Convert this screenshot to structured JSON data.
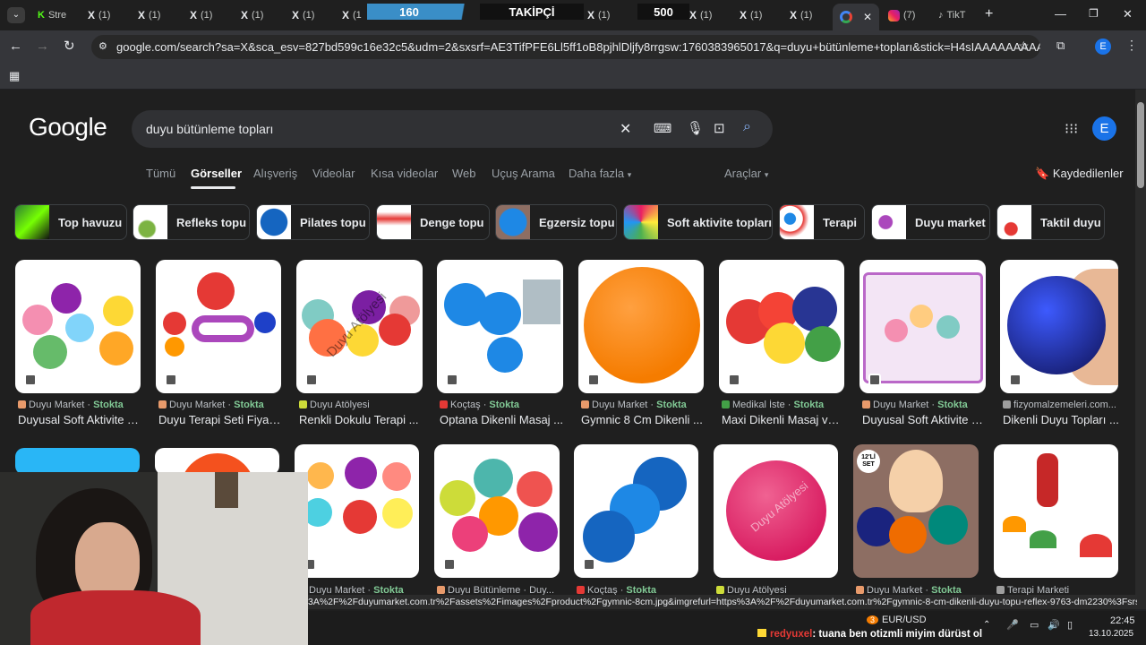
{
  "browser": {
    "tabs": [
      {
        "label": "Stre"
      },
      {
        "label": "(1)"
      },
      {
        "label": "(1)"
      },
      {
        "label": "(1)"
      },
      {
        "label": "(1)"
      },
      {
        "label": "(1)"
      },
      {
        "label": "(1"
      },
      {
        "label": "(1)"
      },
      {
        "label": "(1)"
      },
      {
        "label": "(1)"
      },
      {
        "label": "(1)"
      },
      {
        "label": "(1"
      },
      {
        "label": ""
      },
      {
        "label": "(7)"
      },
      {
        "label": "TikT"
      }
    ],
    "overlay": {
      "count1": "160",
      "label": "TAKİPÇİ",
      "count2": "500"
    },
    "url": "google.com/search?sa=X&sca_esv=827bd599c16e32c5&udm=2&sxsrf=AE3TifPFE6Ll5ff1oB8pjhlDljfy8rrgsw:1760383965017&q=duyu+bütünleme+topları&stick=H4sIAAAAAAAAAFvEKpISWIm...",
    "profile_letter": "E",
    "new_tab": "+"
  },
  "google": {
    "logo": "Google",
    "query": "duyu bütünleme topları",
    "avatar": "E",
    "nav": [
      "Tümü",
      "Görseller",
      "Alışveriş",
      "Videolar",
      "Kısa videolar",
      "Web",
      "Uçuş Arama",
      "Daha fazla"
    ],
    "tools": "Araçlar",
    "saved": "Kaydedilenler",
    "chips": [
      "Top havuzu",
      "Refleks topu",
      "Pilates topu",
      "Denge topu",
      "Egzersiz topu",
      "Soft aktivite topları",
      "Terapi",
      "Duyu market",
      "Taktil duyu"
    ],
    "row1": [
      {
        "source": "Duyu Market",
        "stock": "Stokta",
        "title": "Duyusal Soft Aktivite T..."
      },
      {
        "source": "Duyu Market",
        "stock": "Stokta",
        "title": "Duyu Terapi Seti Fiyatı..."
      },
      {
        "source": "Duyu Atölyesi",
        "stock": "",
        "title": "Renkli Dokulu Terapi ..."
      },
      {
        "source": "Koçtaş",
        "stock": "Stokta",
        "title": "Optana Dikenli Masaj ..."
      },
      {
        "source": "Duyu Market",
        "stock": "Stokta",
        "title": "Gymnic 8 Cm Dikenli ..."
      },
      {
        "source": "Medikal İste",
        "stock": "Stokta",
        "title": "Maxi Dikenli Masaj ve ..."
      },
      {
        "source": "Duyu Market",
        "stock": "Stokta",
        "title": "Duyusal Soft Aktivite T..."
      },
      {
        "source": "fizyomalzemeleri.com...",
        "stock": "",
        "title": "Dikenli Duyu Topları ..."
      }
    ],
    "row2": [
      {
        "source": "Duyu Market",
        "stock": "Stokta"
      },
      {
        "source": "Duyu Bütünleme · Duy...",
        "stock": ""
      },
      {
        "source": "Koçtaş",
        "stock": "Stokta"
      },
      {
        "source": "Duyu Atölyesi",
        "stock": ""
      },
      {
        "source": "Duyu Market",
        "stock": "Stokta"
      },
      {
        "source": "Terapi Marketi",
        "stock": ""
      }
    ],
    "watermark": "Duyu Atölyesi",
    "badge_12": "12'Lİ SET"
  },
  "status_url": "3A%2F%2Fduyumarket.com.tr%2Fassets%2Fimages%2Fproduct%2Fgymnic-8cm.jpg&imgrefurl=https%3A%2F%2Fduyumarket.com.tr%2Fgymnic-8-cm-dikenli-duyu-topu-reflex-9763-dm2230%3Fsrsltid%3...",
  "taskbar": {
    "ticker": "EUR/USD",
    "badge": "3",
    "chat_user": "redyuxel",
    "chat_msg": ": tuana ben otizmli miyim dürüst ol",
    "time": "22:45",
    "date": "13.10.2025"
  },
  "colors": {
    "accent": "#8ab4f8",
    "stock": "#81c995",
    "avatar": "#1a73e8"
  }
}
